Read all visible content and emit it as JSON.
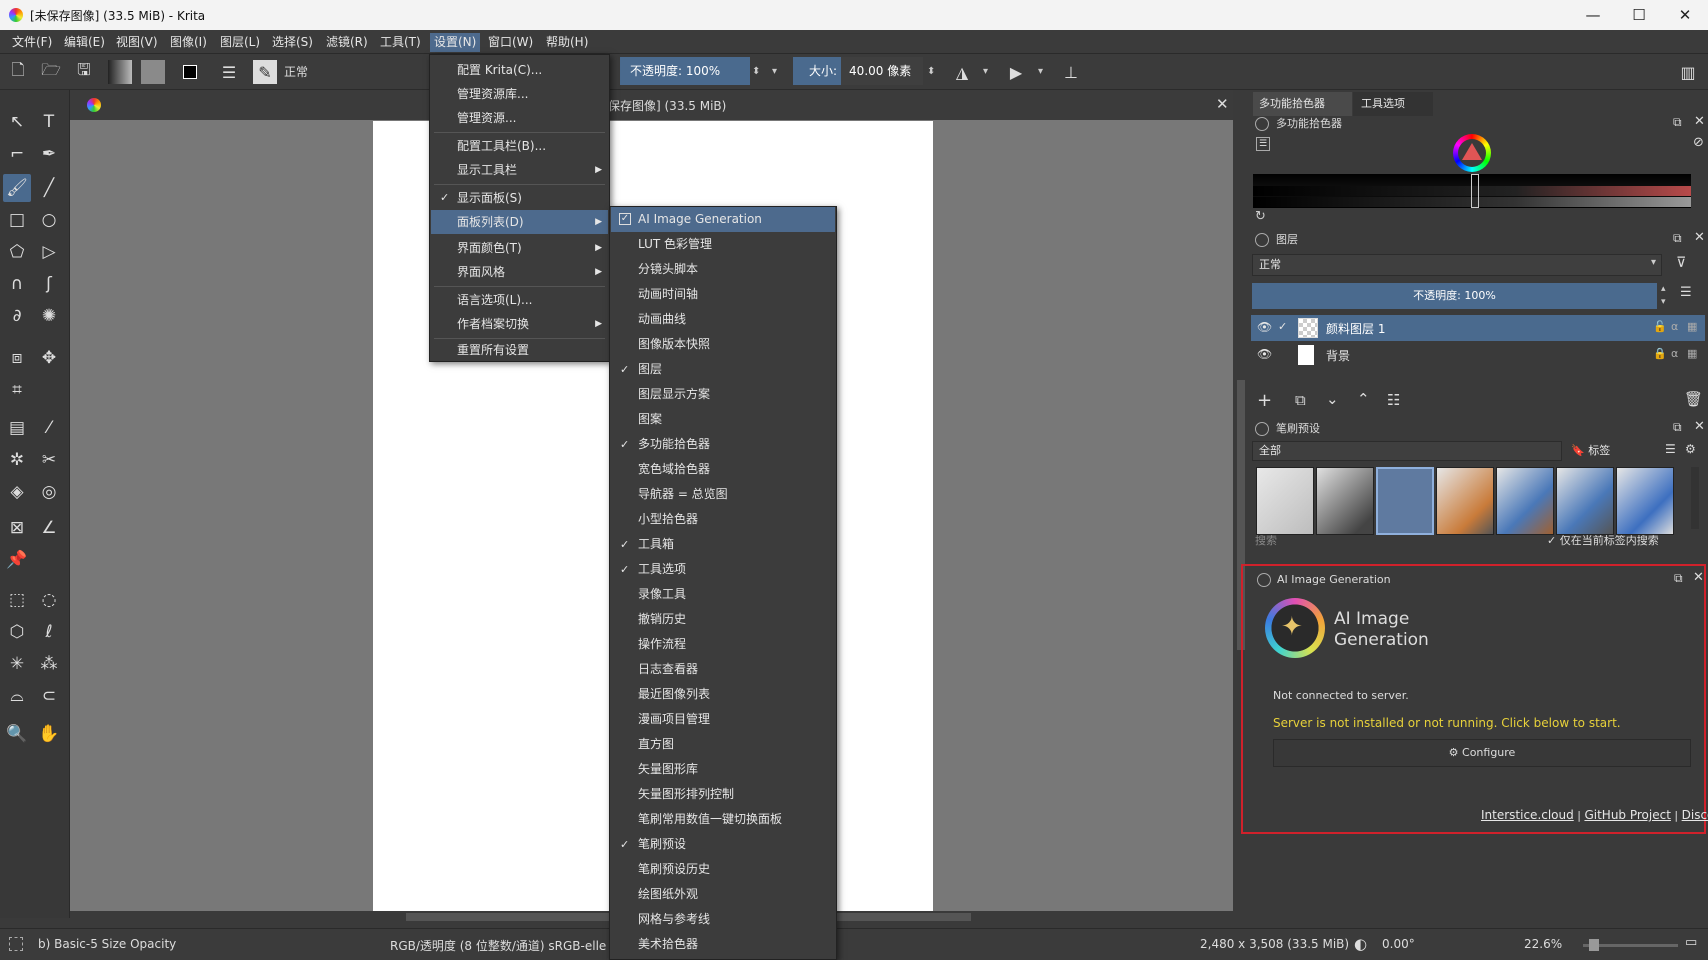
{
  "window": {
    "title": "[未保存图像] (33.5 MiB) - Krita",
    "controls": {
      "minimize": "—",
      "maximize": "☐",
      "close": "✕"
    }
  },
  "menubar": {
    "items": [
      "文件(F)",
      "编辑(E)",
      "视图(V)",
      "图像(I)",
      "图层(L)",
      "选择(S)",
      "滤镜(R)",
      "工具(T)",
      "设置(N)",
      "窗口(W)",
      "帮助(H)"
    ],
    "active": "设置(N)"
  },
  "toolbar": {
    "blend_mode": "正常",
    "opacity_label": "不透明度: 100%",
    "size_prefix": "大小:",
    "size_value": "40.00 像素"
  },
  "document": {
    "tab_title": "保存图像] (33.5 MiB)"
  },
  "settings_menu": {
    "items": [
      {
        "label": "配置 Krita(C)...",
        "submenu": false,
        "checked": false
      },
      {
        "label": "管理资源库...",
        "submenu": false,
        "checked": false
      },
      {
        "label": "管理资源...",
        "submenu": false,
        "checked": false
      },
      {
        "label": "配置工具栏(B)...",
        "submenu": false,
        "checked": false
      },
      {
        "label": "显示工具栏",
        "submenu": true,
        "checked": false
      },
      {
        "label": "显示面板(S)",
        "submenu": false,
        "checked": true
      },
      {
        "label": "面板列表(D)",
        "submenu": true,
        "checked": false,
        "highlighted": true
      },
      {
        "label": "界面颜色(T)",
        "submenu": true,
        "checked": false
      },
      {
        "label": "界面风格",
        "submenu": true,
        "checked": false
      },
      {
        "label": "语言选项(L)...",
        "submenu": false,
        "checked": false
      },
      {
        "label": "作者档案切换",
        "submenu": true,
        "checked": false
      },
      {
        "label": "重置所有设置",
        "submenu": false,
        "checked": false
      }
    ]
  },
  "dockers_menu": {
    "items": [
      {
        "label": "AI Image Generation",
        "checked": true,
        "highlighted": true
      },
      {
        "label": "LUT 色彩管理",
        "checked": false
      },
      {
        "label": "分镜头脚本",
        "checked": false
      },
      {
        "label": "动画时间轴",
        "checked": false
      },
      {
        "label": "动画曲线",
        "checked": false
      },
      {
        "label": "图像版本快照",
        "checked": false
      },
      {
        "label": "图层",
        "checked": true
      },
      {
        "label": "图层显示方案",
        "checked": false
      },
      {
        "label": "图案",
        "checked": false
      },
      {
        "label": "多功能拾色器",
        "checked": true
      },
      {
        "label": "宽色域拾色器",
        "checked": false
      },
      {
        "label": "导航器 = 总览图",
        "checked": false
      },
      {
        "label": "小型拾色器",
        "checked": false
      },
      {
        "label": "工具箱",
        "checked": true
      },
      {
        "label": "工具选项",
        "checked": true
      },
      {
        "label": "录像工具",
        "checked": false
      },
      {
        "label": "撤销历史",
        "checked": false
      },
      {
        "label": "操作流程",
        "checked": false
      },
      {
        "label": "日志查看器",
        "checked": false
      },
      {
        "label": "最近图像列表",
        "checked": false
      },
      {
        "label": "漫画项目管理",
        "checked": false
      },
      {
        "label": "直方图",
        "checked": false
      },
      {
        "label": "矢量图形库",
        "checked": false
      },
      {
        "label": "矢量图形排列控制",
        "checked": false
      },
      {
        "label": "笔刷常用数值一键切换面板",
        "checked": false
      },
      {
        "label": "笔刷预设",
        "checked": true
      },
      {
        "label": "笔刷预设历史",
        "checked": false
      },
      {
        "label": "绘图纸外观",
        "checked": false
      },
      {
        "label": "网格与参考线",
        "checked": false
      },
      {
        "label": "美术拾色器",
        "checked": false
      }
    ]
  },
  "dock": {
    "tabs": [
      "多功能拾色器",
      "工具选项"
    ],
    "color_selector_title": "多功能拾色器",
    "layers": {
      "title": "图层",
      "blend_mode": "正常",
      "opacity": "不透明度: 100%",
      "rows": [
        {
          "name": "颜料图层 1",
          "selected": true
        },
        {
          "name": "背景",
          "selected": false
        }
      ]
    },
    "brush_presets": {
      "title": "笔刷预设",
      "filter": "全部",
      "tag_button": "标签",
      "search_placeholder": "搜索",
      "search_in_tag": "仅在当前标签内搜索"
    },
    "ai": {
      "title": "AI Image Generation",
      "heading": "AI Image\nGeneration",
      "heading_line1": "AI Image",
      "heading_line2": "Generation",
      "status": "Not connected to server.",
      "warning": "Server is not installed or not running. Click below to start.",
      "configure_label": "Configure",
      "links": [
        "Interstice.cloud",
        "GitHub Project",
        "Discord"
      ],
      "warning_color": "#e7d13a"
    }
  },
  "statusbar": {
    "brush": "b) Basic-5 Size Opacity",
    "color_space": "RGB/透明度 (8 位整数/通道)  sRGB-elle",
    "dimensions": "2,480 x 3,508 (33.5 MiB)",
    "rotation": "0.00°",
    "zoom": "22.6%"
  },
  "colors": {
    "accent": "#4d6a8d",
    "highlight_border": "#d0212b"
  }
}
